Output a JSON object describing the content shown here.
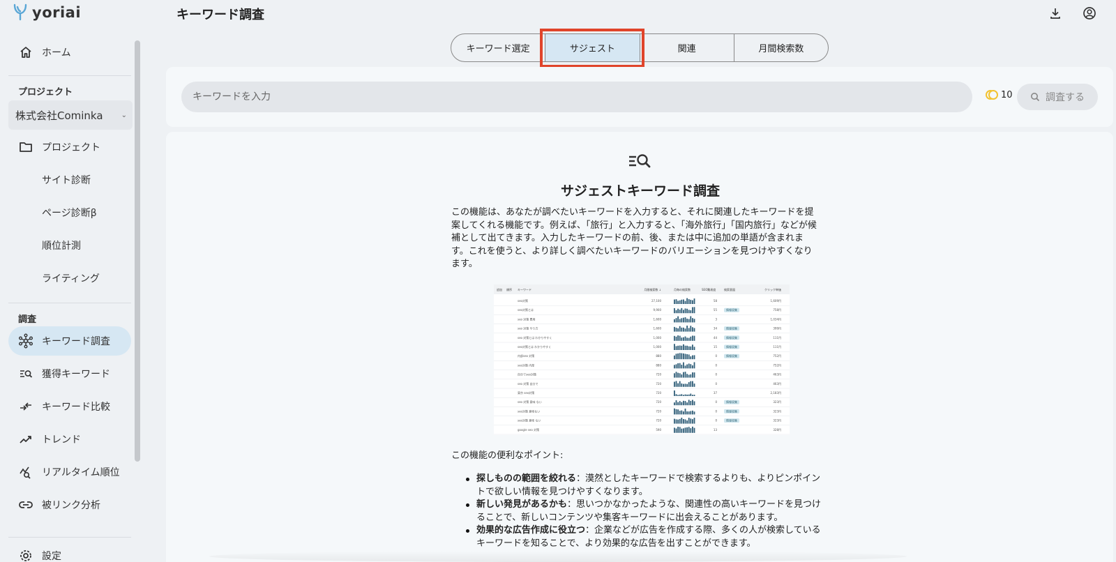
{
  "app": {
    "logo": "yoriai",
    "page_title": "キーワード調査"
  },
  "sidebar": {
    "home": "ホーム",
    "project_section": "プロジェクト",
    "project_selected": "株式会社Cominka",
    "project_items": [
      "プロジェクト",
      "サイト診断",
      "ページ診断β",
      "順位計測",
      "ライティング"
    ],
    "research_section": "調査",
    "research_items": [
      "キーワード調査",
      "獲得キーワード",
      "キーワード比較",
      "トレンド",
      "リアルタイム順位",
      "被リンク分析"
    ],
    "cut_off_item": "設定"
  },
  "tabs": [
    {
      "label": "キーワード選定",
      "active": false
    },
    {
      "label": "サジェスト",
      "active": true
    },
    {
      "label": "関連",
      "active": false
    },
    {
      "label": "月間検索数",
      "active": false
    }
  ],
  "search": {
    "placeholder": "キーワードを入力",
    "credits": "10",
    "button_label": "調査する"
  },
  "feature": {
    "title": "サジェストキーワード調査",
    "description_lines": [
      "この機能は、あなたが調べたいキーワードを入力すると、それに関連したキーワードを提",
      "案してくれる機能です。例えば、「旅行」と入力すると、「海外旅行」「国内旅行」などが候",
      "補として出てきます。入力したキーワードの前、後、または中に追加の単語が含まれま",
      "す。これを使うと、より詳しく調べたいキーワードのバリエーションを見つけやすくなり",
      "ます。"
    ],
    "points_title": "この機能の便利なポイント:",
    "points": [
      {
        "bold": "探しものの範囲を絞れる",
        "text": "：漠然としたキーワードで検索するよりも、よりピンポイントで欲しい情報を見つけやすくなります。"
      },
      {
        "bold": "新しい発見があるかも",
        "text": "：思いつかなかったような、関連性の高いキーワードを見つけることで、新しいコンテンツや集客キーワードに出会えることがあります。"
      },
      {
        "bold": "効果的な広告作成に役立つ",
        "text": "：企業などが広告を作成する際、多くの人が検索しているキーワードを知ることで、より効果的な広告を出すことができます。"
      }
    ]
  },
  "preview": {
    "headers": [
      "追加",
      "順序",
      "キーワード",
      "月間検索数 ↓",
      "月毎の検索数",
      "SEO難易度",
      "検索意図",
      "クリック単価"
    ],
    "rows": [
      {
        "kw": "seo対策",
        "vol": "27,100",
        "seo": "58",
        "intent": "",
        "cpc": "1,609円"
      },
      {
        "kw": "seo対策とは",
        "vol": "9,900",
        "seo": "55",
        "intent": "情報収集",
        "cpc": "758円"
      },
      {
        "kw": "seo 対策 費用",
        "vol": "1,600",
        "seo": "3",
        "intent": "",
        "cpc": "1,034円"
      },
      {
        "kw": "seo 対策 やり方",
        "vol": "1,600",
        "seo": "34",
        "intent": "情報収集",
        "cpc": "399円"
      },
      {
        "kw": "seo 対策とは わかりやすく",
        "vol": "1,000",
        "seo": "44",
        "intent": "情報収集",
        "cpc": "111円"
      },
      {
        "kw": "seo対策とは わかりやすく",
        "vol": "1,000",
        "seo": "15",
        "intent": "情報収集",
        "cpc": "111円"
      },
      {
        "kw": "内部seo 対策",
        "vol": "880",
        "seo": "0",
        "intent": "情報収集",
        "cpc": "752円"
      },
      {
        "kw": "seo対策 内部",
        "vol": "880",
        "seo": "0",
        "intent": "",
        "cpc": "752円"
      },
      {
        "kw": "自分でseo対策",
        "vol": "720",
        "seo": "0",
        "intent": "",
        "cpc": "463円"
      },
      {
        "kw": "seo 対策 自分で",
        "vol": "720",
        "seo": "0",
        "intent": "",
        "cpc": "463円"
      },
      {
        "kw": "東京 seo対策",
        "vol": "720",
        "seo": "37",
        "intent": "",
        "cpc": "2,183円"
      },
      {
        "kw": "seo 対策 意味 ない",
        "vol": "720",
        "seo": "0",
        "intent": "情報収集",
        "cpc": "323円"
      },
      {
        "kw": "seo対策 意味ない",
        "vol": "720",
        "seo": "0",
        "intent": "情報収集",
        "cpc": "323円"
      },
      {
        "kw": "seo対策 意味 ない",
        "vol": "720",
        "seo": "0",
        "intent": "情報収集",
        "cpc": "323円"
      },
      {
        "kw": "google seo 対策",
        "vol": "590",
        "seo": "13",
        "intent": "",
        "cpc": "328円"
      }
    ]
  },
  "colors": {
    "accent": "#d6e7f3",
    "highlight": "#e0442a",
    "credit_icon": "#f2c230"
  },
  "icons": [
    "home-icon",
    "folder-icon",
    "network-icon",
    "list-search-icon",
    "compare-icon",
    "trend-icon",
    "realtime-rank-icon",
    "link-icon",
    "download-icon",
    "user-icon",
    "search-icon",
    "coin-icon"
  ]
}
